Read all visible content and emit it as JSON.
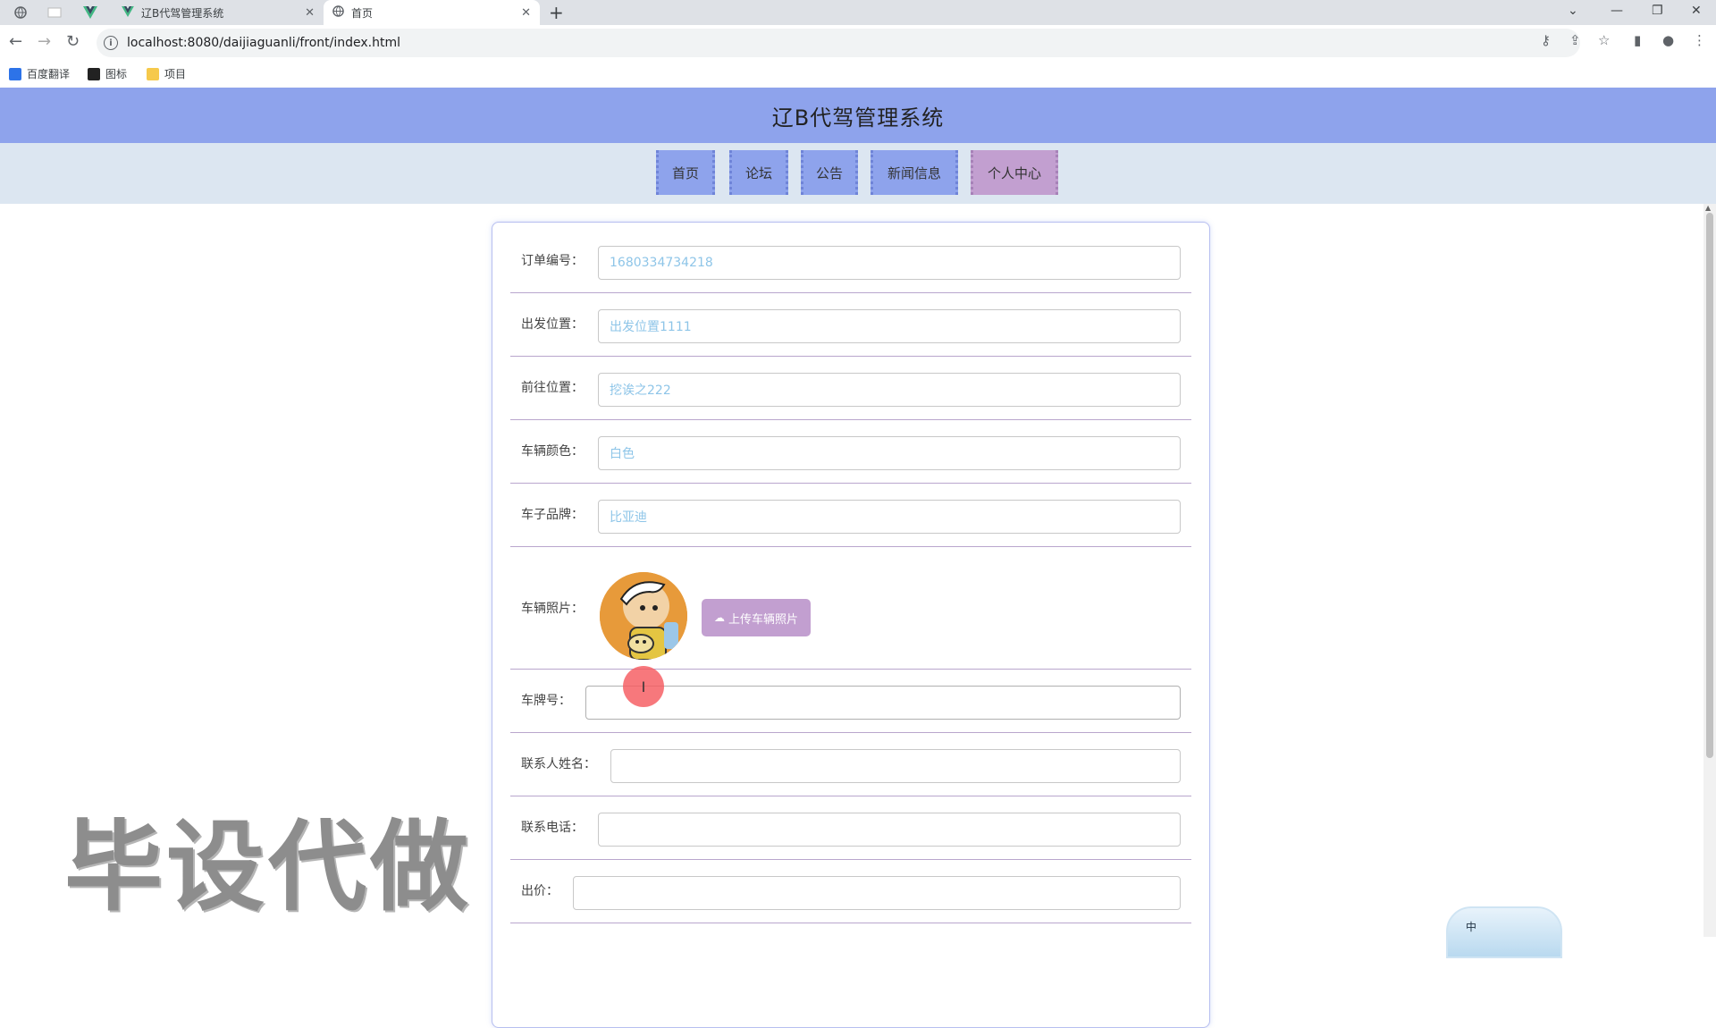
{
  "browser": {
    "tabs": [
      {
        "title": "辽B代驾管理系统",
        "active": false
      },
      {
        "title": "首页",
        "active": true
      }
    ],
    "url": "localhost:8080/daijiaguanli/front/index.html",
    "bookmarks": [
      "百度翻译",
      "图标",
      "项目"
    ]
  },
  "site": {
    "title": "辽B代驾管理系统",
    "nav": [
      "首页",
      "论坛",
      "公告",
      "新闻信息",
      "个人中心"
    ],
    "active_nav": "个人中心"
  },
  "form": {
    "fields": {
      "order_no": {
        "label": "订单编号：",
        "value": "1680334734218"
      },
      "depart": {
        "label": "出发位置：",
        "value": "出发位置1111"
      },
      "destination": {
        "label": "前往位置：",
        "value": "挖诶之222"
      },
      "car_color": {
        "label": "车辆颜色：",
        "value": "白色"
      },
      "car_brand": {
        "label": "车子品牌：",
        "value": "比亚迪"
      },
      "car_photo": {
        "label": "车辆照片：",
        "upload_label": "上传车辆照片"
      },
      "plate": {
        "label": "车牌号：",
        "value": ""
      },
      "contact_name": {
        "label": "联系人姓名：",
        "value": ""
      },
      "contact_phone": {
        "label": "联系电话：",
        "value": ""
      },
      "price": {
        "label": "出价：",
        "value": ""
      }
    }
  },
  "overlay": {
    "watermark": "毕设代做",
    "ime": "中"
  },
  "colors": {
    "header": "#8ea3ec",
    "nav_bg": "#dce6f1",
    "active_nav": "#c29fd0",
    "input_text": "#8ec5e8"
  }
}
